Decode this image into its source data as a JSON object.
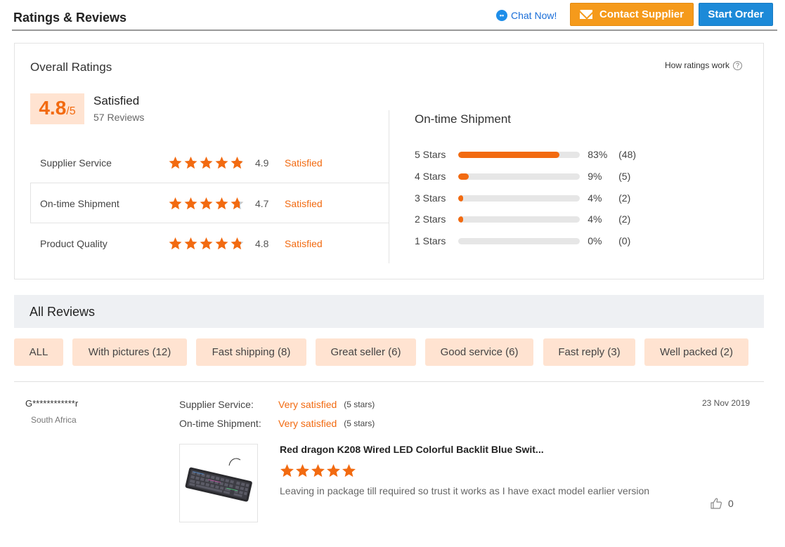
{
  "header": {
    "title": "Ratings & Reviews",
    "chat_label": "Chat Now!",
    "contact_label": "Contact Supplier",
    "start_label": "Start Order"
  },
  "overall": {
    "title": "Overall Ratings",
    "how_label": "How ratings work",
    "score": "4.8",
    "score_suffix": "/5",
    "status": "Satisfied",
    "reviews_count": "57 Reviews",
    "rows": [
      {
        "label": "Supplier Service",
        "value": "4.9",
        "status": "Satisfied",
        "rating": 4.9
      },
      {
        "label": "On-time Shipment",
        "value": "4.7",
        "status": "Satisfied",
        "rating": 4.7
      },
      {
        "label": "Product Quality",
        "value": "4.8",
        "status": "Satisfied",
        "rating": 4.8
      }
    ]
  },
  "shipment": {
    "title": "On-time Shipment",
    "bars": [
      {
        "label": "5  Stars",
        "pct": "83%",
        "count": "(48)",
        "fraction": 0.83
      },
      {
        "label": "4  Stars",
        "pct": "9%",
        "count": "(5)",
        "fraction": 0.09
      },
      {
        "label": "3  Stars",
        "pct": "4%",
        "count": "(2)",
        "fraction": 0.04
      },
      {
        "label": "2  Stars",
        "pct": "4%",
        "count": "(2)",
        "fraction": 0.04
      },
      {
        "label": "1  Stars",
        "pct": "0%",
        "count": "(0)",
        "fraction": 0
      }
    ]
  },
  "all_reviews": {
    "title": "All Reviews",
    "filters": [
      "ALL",
      "With pictures (12)",
      "Fast shipping (8)",
      "Great seller (6)",
      "Good service (6)",
      "Fast reply (3)",
      "Well packed (2)"
    ]
  },
  "review": {
    "name": "G************r",
    "country": "South Africa",
    "date": "23 Nov 2019",
    "supplier_label": "Supplier Service:",
    "supplier_value": "Very satisfied",
    "supplier_stars": "(5 stars)",
    "shipment_label": "On-time Shipment:",
    "shipment_value": "Very satisfied",
    "shipment_stars": "(5 stars)",
    "product_title": "Red dragon K208 Wired LED Colorful Backlit Blue Swit...",
    "rating": 5,
    "text": "Leaving in package till required so trust it works as I have exact model earlier version",
    "likes": "0"
  },
  "colors": {
    "accent": "#f26a10",
    "contact_button": "#f59a1b",
    "start_button": "#1c8ad8",
    "chip_bg": "#ffe3d1",
    "star_empty": "#c8c8c8"
  },
  "icons": [
    "chat-icon",
    "envelope-icon",
    "help-icon",
    "star-icon",
    "thumbs-up-icon"
  ]
}
